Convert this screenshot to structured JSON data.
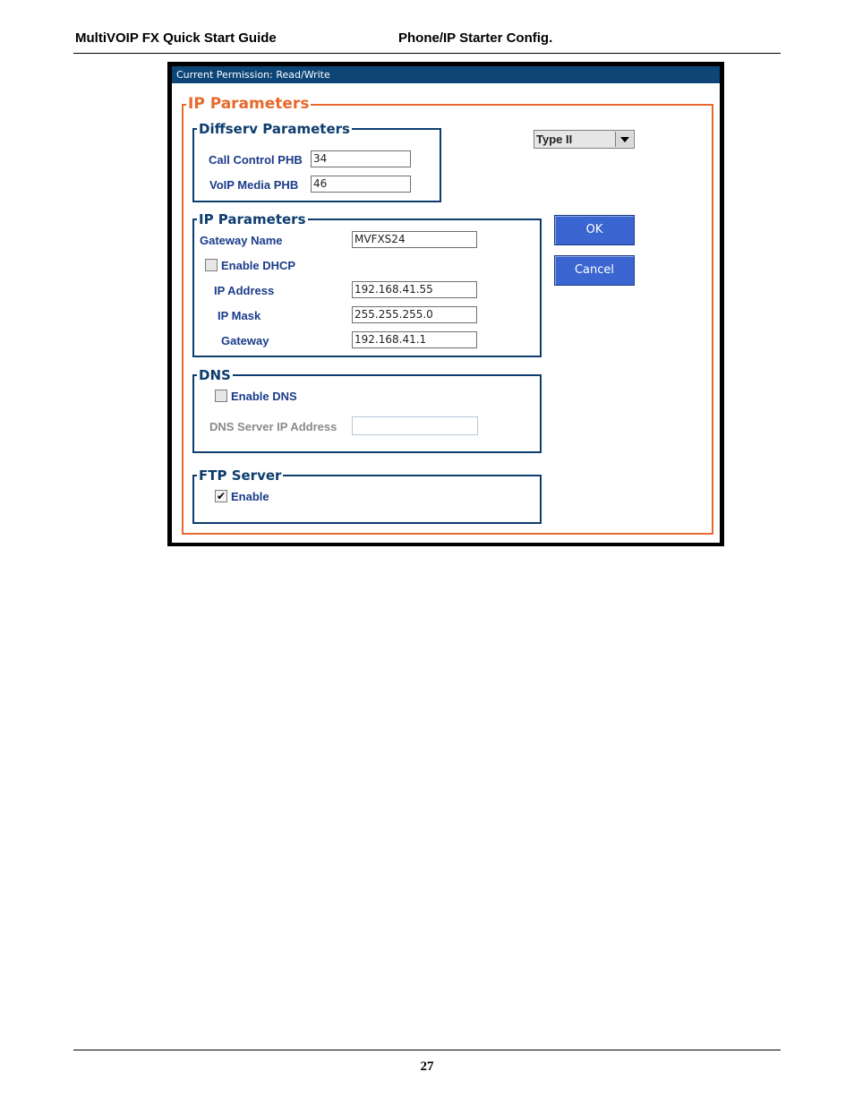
{
  "doc": {
    "header_left": "MultiVOIP FX Quick Start Guide",
    "header_right": "Phone/IP Starter Config.",
    "page_number": "27"
  },
  "window": {
    "status": "Current Permission:  Read/Write"
  },
  "ip_parameters": {
    "legend": "IP Parameters"
  },
  "diffserv": {
    "legend": "Diffserv Parameters",
    "call_control_label": "Call Control PHB",
    "call_control_value": "34",
    "voip_media_label": "VoIP Media PHB",
    "voip_media_value": "46"
  },
  "type_select": {
    "value": "Type II"
  },
  "buttons": {
    "ok": "OK",
    "cancel": "Cancel"
  },
  "ip_section": {
    "legend": "IP Parameters",
    "gateway_name_label": "Gateway Name",
    "gateway_name_value": "MVFXS24",
    "enable_dhcp_label": "Enable DHCP",
    "enable_dhcp_checked": false,
    "ip_address_label": "IP Address",
    "ip_address_value": "192.168.41.55",
    "ip_mask_label": "IP Mask",
    "ip_mask_value": "255.255.255.0",
    "gateway_label": "Gateway",
    "gateway_value": "192.168.41.1"
  },
  "dns": {
    "legend": "DNS",
    "enable_dns_label": "Enable DNS",
    "enable_dns_checked": false,
    "server_label": "DNS Server IP Address",
    "server_value": ""
  },
  "ftp": {
    "legend": "FTP Server",
    "enable_label": "Enable",
    "enable_checked": true,
    "check_glyph": "✔"
  },
  "colors": {
    "titlebar": "#0d4577",
    "orange_accent": "#e8692b",
    "blue_border": "#0d3d6e",
    "label_blue": "#1a3c8a",
    "button_blue": "#3b66d1"
  }
}
